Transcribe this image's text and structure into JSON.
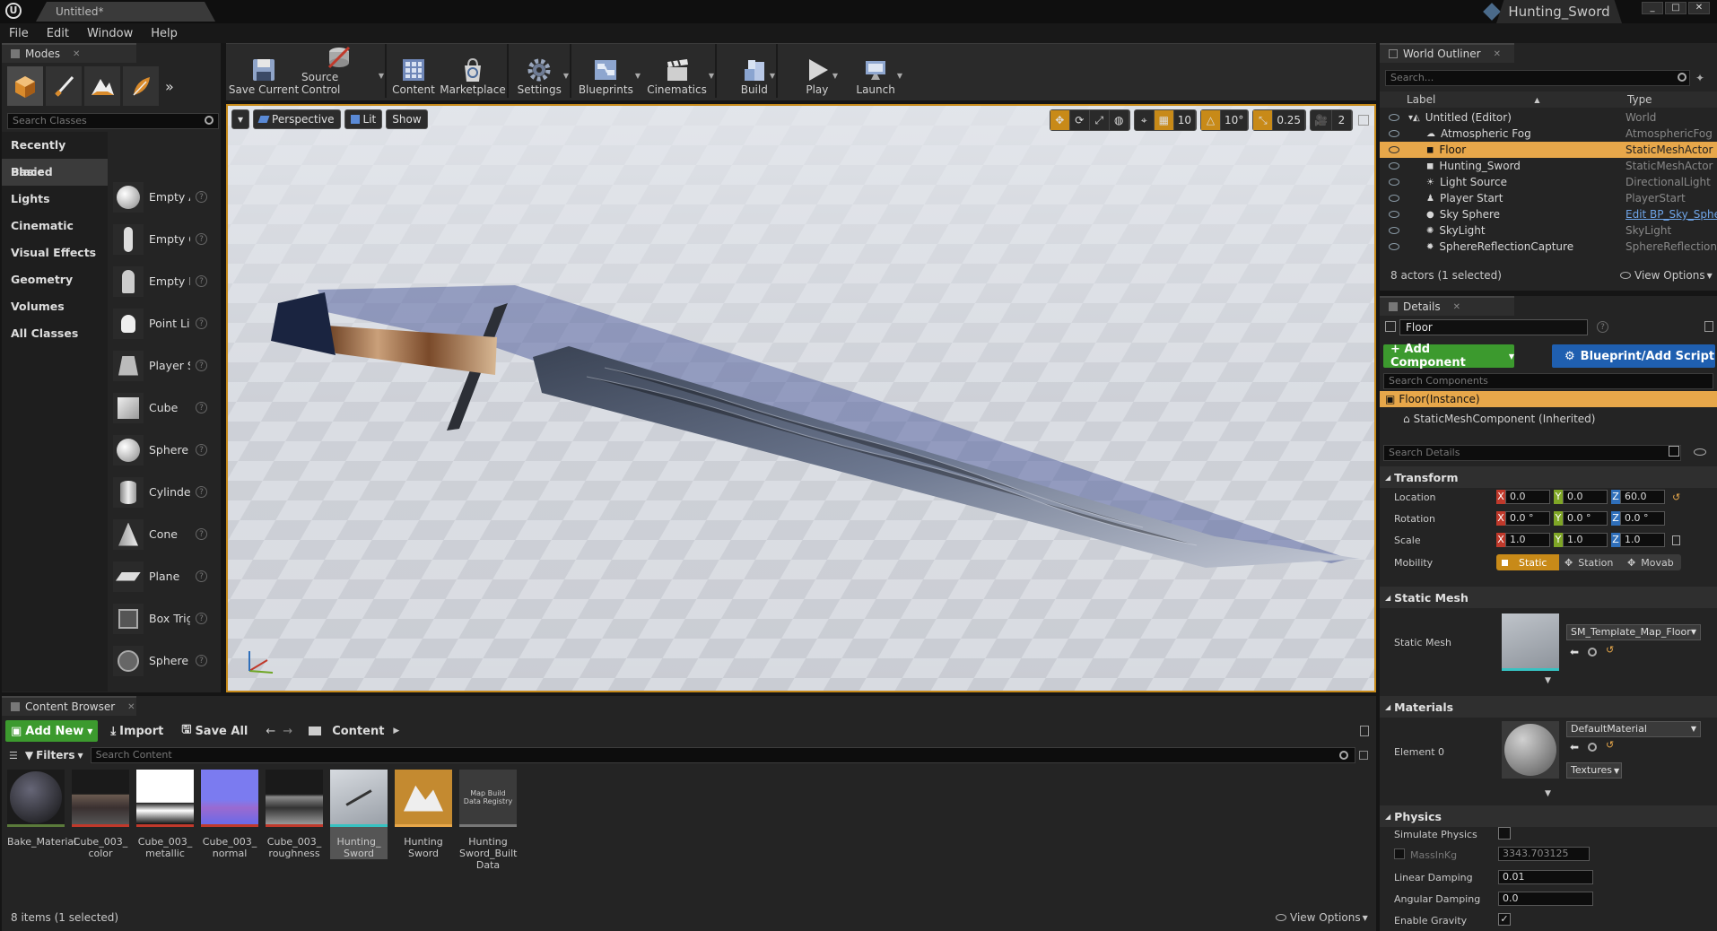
{
  "window": {
    "doc_tab": "Untitled*",
    "project_tab": "Hunting_Sword",
    "menu": [
      "File",
      "Edit",
      "Window",
      "Help"
    ]
  },
  "modes": {
    "tab": "Modes",
    "search_placeholder": "Search Classes",
    "categories": [
      "Recently Placed",
      "Basic",
      "Lights",
      "Cinematic",
      "Visual Effects",
      "Geometry",
      "Volumes",
      "All Classes"
    ],
    "active_category": "Basic",
    "items": [
      "Empty A",
      "Empty C",
      "Empty P",
      "Point Lig",
      "Player S",
      "Cube",
      "Sphere",
      "Cylinder",
      "Cone",
      "Plane",
      "Box Trig",
      "Sphere "
    ]
  },
  "toolbar": {
    "buttons": [
      "Save Current",
      "Source Control",
      "Content",
      "Marketplace",
      "Settings",
      "Blueprints",
      "Cinematics",
      "Build",
      "Play",
      "Launch"
    ]
  },
  "viewport": {
    "view_mode": "Perspective",
    "lit": "Lit",
    "show": "Show",
    "grid_snap": "10",
    "rot_snap": "10°",
    "scale_snap": "0.25",
    "cam_speed": "2"
  },
  "outliner": {
    "tab": "World Outliner",
    "search_placeholder": "Search...",
    "col_label": "Label",
    "col_type": "Type",
    "rows": [
      {
        "label": "Untitled (Editor)",
        "type": "World"
      },
      {
        "label": "Atmospheric Fog",
        "type": "AtmosphericFog"
      },
      {
        "label": "Floor",
        "type": "StaticMeshActor"
      },
      {
        "label": "Hunting_Sword",
        "type": "StaticMeshActor"
      },
      {
        "label": "Light Source",
        "type": "DirectionalLight"
      },
      {
        "label": "Player Start",
        "type": "PlayerStart"
      },
      {
        "label": "Sky Sphere",
        "type": "Edit BP_Sky_Sphe"
      },
      {
        "label": "SkyLight",
        "type": "SkyLight"
      },
      {
        "label": "SphereReflectionCapture",
        "type": "SphereReflectionC"
      }
    ],
    "footer": "8 actors (1 selected)",
    "view_options": "View Options"
  },
  "details": {
    "tab": "Details",
    "name": "Floor",
    "add_component": "+ Add Component",
    "blueprint": "Blueprint/Add Script",
    "search_components": "Search Components",
    "instance": "Floor(Instance)",
    "component": "StaticMeshComponent (Inherited)",
    "search_details": "Search Details",
    "transform": "Transform",
    "location_label": "Location",
    "rotation_label": "Rotation",
    "scale_label": "Scale",
    "mobility_label": "Mobility",
    "location": [
      "0.0",
      "0.0",
      "60.0"
    ],
    "rotation": [
      "0.0 °",
      "0.0 °",
      "0.0 °"
    ],
    "scale": [
      "1.0",
      "1.0",
      "1.0"
    ],
    "mobility": [
      "Static",
      "Station",
      "Movab"
    ],
    "static_mesh_section": "Static Mesh",
    "static_mesh_label": "Static Mesh",
    "static_mesh_value": "SM_Template_Map_Floor",
    "materials_section": "Materials",
    "element0_label": "Element 0",
    "material_value": "DefaultMaterial",
    "textures": "Textures",
    "physics_section": "Physics",
    "simulate_physics": "Simulate Physics",
    "mass_label": "MassInKg",
    "mass_value": "3343.703125",
    "linear_damping_label": "Linear Damping",
    "linear_damping": "0.01",
    "angular_damping_label": "Angular Damping",
    "angular_damping": "0.0",
    "gravity_label": "Enable Gravity"
  },
  "content_browser": {
    "tab": "Content Browser",
    "add_new": "Add New",
    "import": "Import",
    "save_all": "Save All",
    "path": "Content",
    "filters": "Filters",
    "search_placeholder": "Search Content",
    "assets": [
      "Bake_Material",
      "Cube_003_ color",
      "Cube_003_ metallic",
      "Cube_003_ normal",
      "Cube_003_ roughness",
      "Hunting_ Sword",
      "Hunting Sword",
      "Hunting Sword_Built Data"
    ],
    "map_build_thumb": "Map Build Data Registry",
    "footer": "8 items (1 selected)",
    "view_options": "View Options"
  },
  "colors": {
    "accent_orange": "#e7a74a",
    "add_green": "#3c9a2e",
    "blueprint_blue": "#1f5fb0",
    "viewport_border": "#c68a1a"
  }
}
